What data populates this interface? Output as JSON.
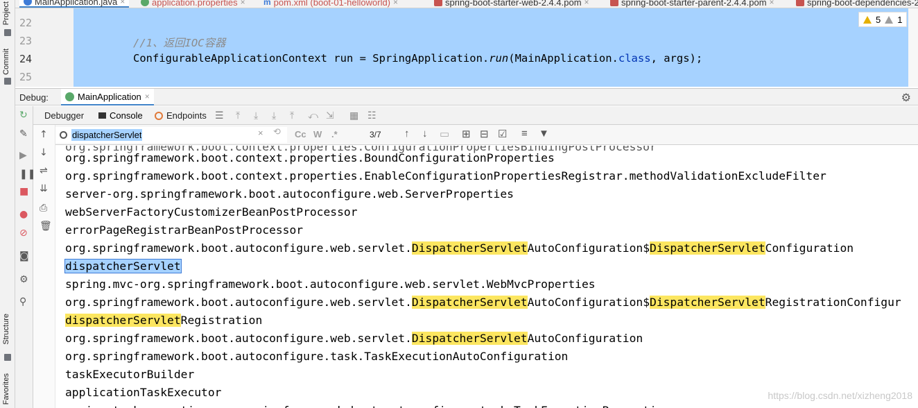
{
  "left_strip": {
    "project": "Project",
    "commit": "Commit",
    "structure": "Structure",
    "favorites": "Favorites"
  },
  "tabs": [
    {
      "label": "MainApplication.java",
      "icon": "java-class-icon",
      "active": true
    },
    {
      "label": "application.properties",
      "icon": "properties-icon"
    },
    {
      "label": "pom.xml (boot-01-helloworld)",
      "icon": "maven-icon"
    },
    {
      "label": "spring-boot-starter-web-2.4.4.pom",
      "icon": "xml-icon"
    },
    {
      "label": "spring-boot-starter-parent-2.4.4.pom",
      "icon": "xml-icon"
    },
    {
      "label": "spring-boot-dependencies-2.",
      "icon": "xml-icon"
    }
  ],
  "editor": {
    "line_numbers": [
      "22",
      "23",
      "24",
      "25"
    ],
    "comment": "//1、返回IOC容器",
    "code_parts": {
      "type": "ConfigurableApplicationContext run = SpringApplication.",
      "method": "run",
      "open": "(MainApplication.",
      "kw": "class",
      "close": ", args);"
    },
    "warnings": "5",
    "weak_warnings": "1"
  },
  "debug": {
    "label": "Debug:",
    "config_tab": "MainApplication",
    "tabs": {
      "debugger": "Debugger",
      "console": "Console",
      "endpoints": "Endpoints"
    }
  },
  "search": {
    "query": "dispatcherServlet",
    "match_count": "3/7",
    "opt_case": "Cc",
    "opt_word": "W",
    "opt_regex": ".*"
  },
  "console_lines": [
    {
      "segments": [
        "org.springframework.boot.context.properties.BoundConfigurationProperties"
      ]
    },
    {
      "segments": [
        "org.springframework.boot.context.properties.EnableConfigurationPropertiesRegistrar.methodValidationExcludeFilter"
      ]
    },
    {
      "segments": [
        "server-org.springframework.boot.autoconfigure.web.ServerProperties"
      ]
    },
    {
      "segments": [
        "webServerFactoryCustomizerBeanPostProcessor"
      ]
    },
    {
      "segments": [
        "errorPageRegistrarBeanPostProcessor"
      ]
    },
    {
      "segments": [
        "org.springframework.boot.autoconfigure.web.servlet.",
        "DispatcherServlet",
        "AutoConfiguration$",
        "DispatcherServlet",
        "Configuration"
      ]
    },
    {
      "segments": [
        "",
        "dispatcherServlet"
      ]
    },
    {
      "segments": [
        "spring.mvc-org.springframework.boot.autoconfigure.web.servlet.WebMvcProperties"
      ]
    },
    {
      "segments": [
        "org.springframework.boot.autoconfigure.web.servlet.",
        "DispatcherServlet",
        "AutoConfiguration$",
        "DispatcherServlet",
        "RegistrationConfigur"
      ]
    },
    {
      "segments": [
        "",
        "dispatcherServlet",
        "Registration"
      ]
    },
    {
      "segments": [
        "org.springframework.boot.autoconfigure.web.servlet.",
        "DispatcherServlet",
        "AutoConfiguration"
      ]
    },
    {
      "segments": [
        "org.springframework.boot.autoconfigure.task.TaskExecutionAutoConfiguration"
      ]
    },
    {
      "segments": [
        "taskExecutorBuilder"
      ]
    },
    {
      "segments": [
        "applicationTaskExecutor"
      ]
    },
    {
      "segments": [
        "spring.task.execution-org.springframework.boot.autoconfigure.task.TaskExecutionProperties"
      ]
    }
  ],
  "watermark": "https://blog.csdn.net/xizheng2018"
}
